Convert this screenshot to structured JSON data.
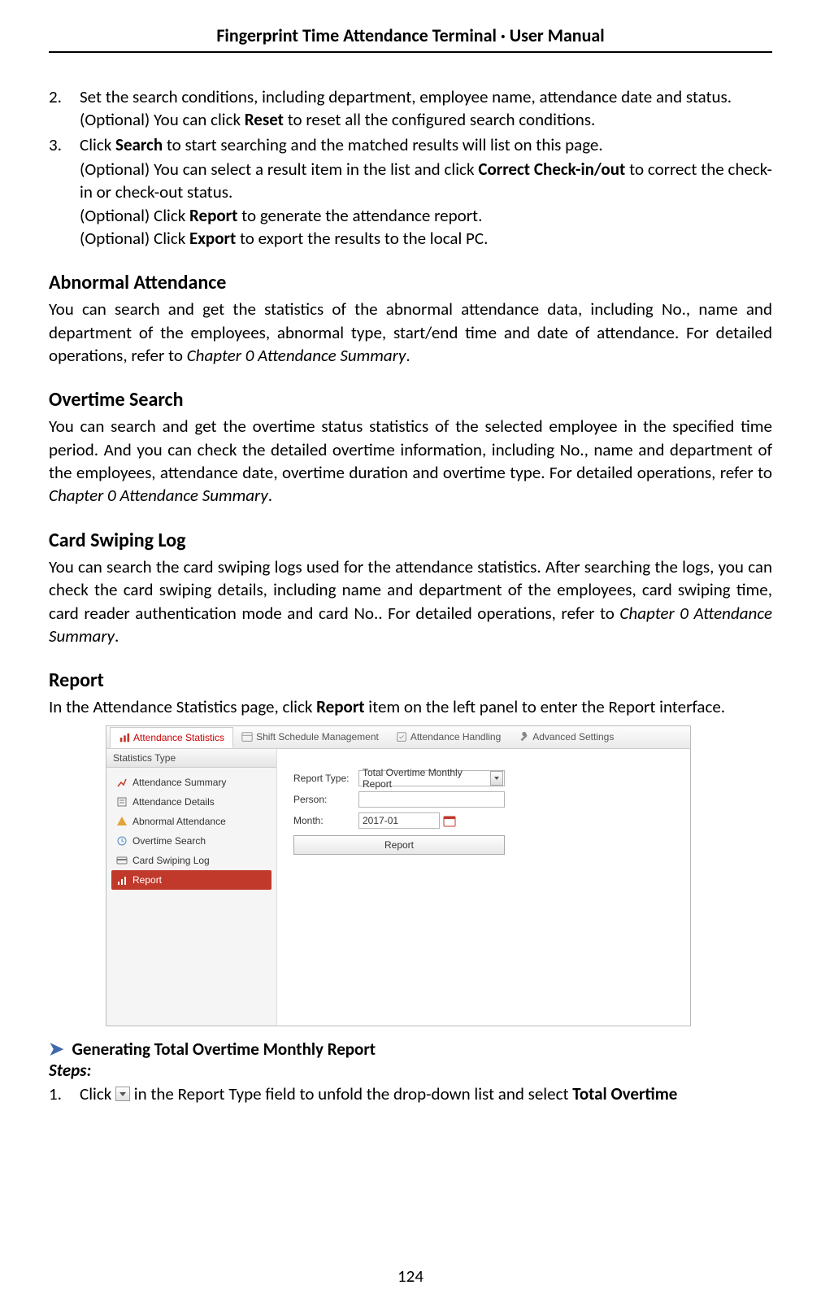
{
  "header": {
    "title": "Fingerprint Time Attendance Terminal · User Manual"
  },
  "list": {
    "item2_num": "2.",
    "item2_text_a": "Set the search conditions, including department, employee name, attendance date and status.",
    "item2_text_b_pre": "(Optional) You can click ",
    "item2_text_b_bold": "Reset",
    "item2_text_b_post": " to reset all the configured search conditions.",
    "item3_num": "3.",
    "item3_text_a_pre": "Click ",
    "item3_text_a_bold": "Search",
    "item3_text_a_post": " to start searching and the matched results will list on this page.",
    "item3_text_b_pre": "(Optional) You can select a result item in the list and click ",
    "item3_text_b_bold": "Correct Check-in/out",
    "item3_text_b_post": " to correct the check-in or check-out status.",
    "item3_text_c_pre": "(Optional) Click ",
    "item3_text_c_bold": "Report",
    "item3_text_c_post": " to generate the attendance report.",
    "item3_text_d_pre": "(Optional) Click ",
    "item3_text_d_bold": "Export",
    "item3_text_d_post": " to export the results to the local PC."
  },
  "sections": {
    "abnormal_h": "Abnormal Attendance",
    "abnormal_p_pre": "You can search and get the statistics of the abnormal attendance data, including No., name and department of the employees, abnormal type, start/end time and date of attendance. For detailed operations, refer to ",
    "abnormal_p_italic": "Chapter 0 Attendance Summary",
    "abnormal_p_post": ".",
    "overtime_h": "Overtime Search",
    "overtime_p_pre": "You can search and get the overtime status statistics of the selected employee in the specified time period. And you can check the detailed overtime information, including No., name and department of the employees, attendance date, overtime duration and overtime type. For detailed operations, refer to ",
    "overtime_p_italic": "Chapter 0 Attendance Summary",
    "overtime_p_post": ".",
    "cardlog_h": "Card Swiping Log",
    "cardlog_p_pre": "You can search the card swiping logs used for the attendance statistics. After searching the logs, you can check the card swiping details, including name and department of the employees, card swiping time, card reader authentication mode and card No.. For detailed operations, refer to ",
    "cardlog_p_italic": "Chapter 0 Attendance Summary",
    "cardlog_p_post": ".",
    "report_h": "Report",
    "report_p_pre": "In the Attendance Statistics page, click ",
    "report_p_bold": "Report",
    "report_p_post": " item on the left panel to enter the Report interface."
  },
  "app": {
    "tabs": {
      "t0": "Attendance Statistics",
      "t1": "Shift Schedule Management",
      "t2": "Attendance Handling",
      "t3": "Advanced Settings"
    },
    "sidebar": {
      "header": "Statistics Type",
      "items": {
        "i0": "Attendance Summary",
        "i1": "Attendance Details",
        "i2": "Abnormal Attendance",
        "i3": "Overtime Search",
        "i4": "Card Swiping Log",
        "i5": "Report"
      }
    },
    "form": {
      "report_type_label": "Report Type:",
      "report_type_value": "Total Overtime Monthly Report",
      "person_label": "Person:",
      "person_value": "",
      "month_label": "Month:",
      "month_value": "2017-01",
      "button": "Report"
    }
  },
  "gen": {
    "heading": "Generating Total Overtime Monthly Report",
    "steps_label": "Steps:",
    "step1_num": "1.",
    "step1_pre": "Click ",
    "step1_mid": " in the Report Type field to unfold the drop-down list and select ",
    "step1_bold": "Total Overtime"
  },
  "page_number": "124"
}
